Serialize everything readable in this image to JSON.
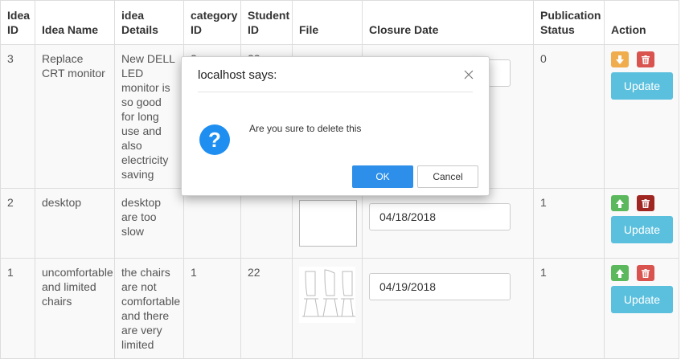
{
  "table": {
    "headers": [
      "Idea ID",
      "Idea Name",
      "idea Details",
      "category ID",
      "Student ID",
      "File",
      "Closure Date",
      "Publication Status",
      "Action"
    ],
    "rows": [
      {
        "idea_id": "3",
        "idea_name": "Replace CRT monitor",
        "idea_details": "New DELL LED monitor is so good for long use and also electricity saving",
        "category_id": "2",
        "student_id": "22",
        "file": "none",
        "closure_date": "",
        "publication_status": "0",
        "toggle_icon": "arrow-down-icon",
        "update_label": "Update"
      },
      {
        "idea_id": "2",
        "idea_name": "desktop",
        "idea_details": "desktop are too slow",
        "category_id": "",
        "student_id": "",
        "file": "blank-thumbnail",
        "closure_date": "04/18/2018",
        "publication_status": "1",
        "toggle_icon": "arrow-up-icon",
        "update_label": "Update"
      },
      {
        "idea_id": "1",
        "idea_name": "uncomfortable and limited chairs",
        "idea_details": "the chairs are not comfortable and there are very limited",
        "category_id": "1",
        "student_id": "22",
        "file": "chairs-thumbnail",
        "closure_date": "04/19/2018",
        "publication_status": "1",
        "toggle_icon": "arrow-up-icon",
        "update_label": "Update"
      }
    ]
  },
  "dialog": {
    "title": "localhost says:",
    "message": "Are you sure to delete this",
    "ok_label": "OK",
    "cancel_label": "Cancel",
    "icon": "question-icon"
  },
  "colors": {
    "update": "#5bc0de",
    "delete": "#d9534f",
    "publish_up": "#5cb85c",
    "unpublish_down": "#f0ad4e",
    "ok": "#2d8fe9"
  }
}
